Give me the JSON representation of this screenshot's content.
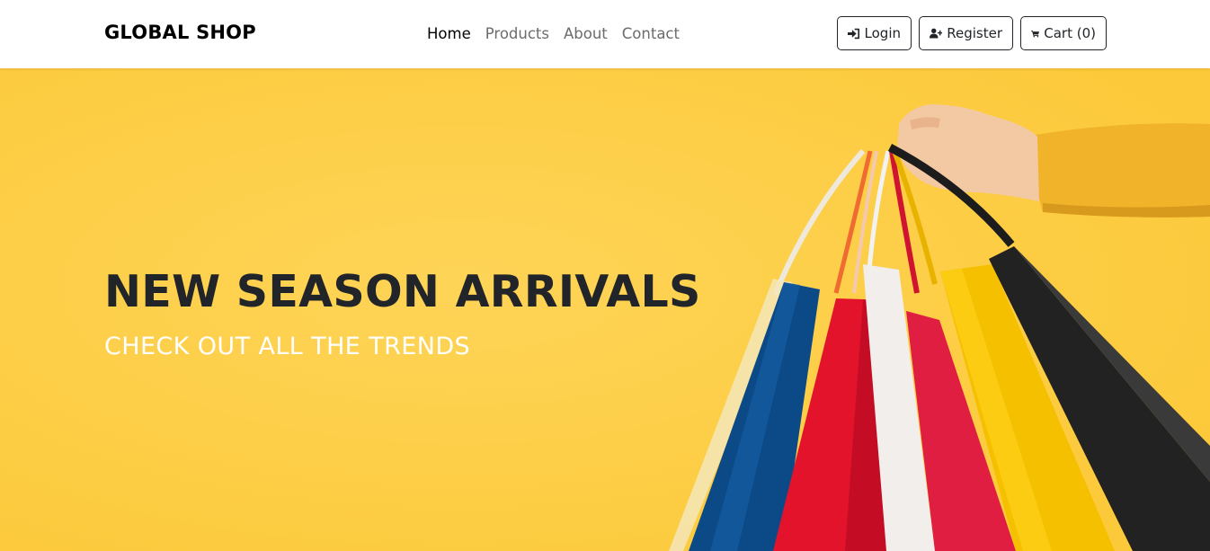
{
  "brand": {
    "name": "GLOBAL SHOP"
  },
  "nav": {
    "links": [
      {
        "label": "Home",
        "active": true
      },
      {
        "label": "Products",
        "active": false
      },
      {
        "label": "About",
        "active": false
      },
      {
        "label": "Contact",
        "active": false
      }
    ]
  },
  "buttons": {
    "login": {
      "label": "Login",
      "icon": "sign-in-icon"
    },
    "register": {
      "label": "Register",
      "icon": "user-plus-icon"
    },
    "cart": {
      "label": "Cart (0)",
      "icon": "shopping-cart-icon"
    }
  },
  "hero": {
    "title": "NEW SEASON ARRIVALS",
    "subtitle": "CHECK OUT ALL THE TRENDS",
    "image": "shopping-bags-photo",
    "background_color": "#fdcd41"
  }
}
